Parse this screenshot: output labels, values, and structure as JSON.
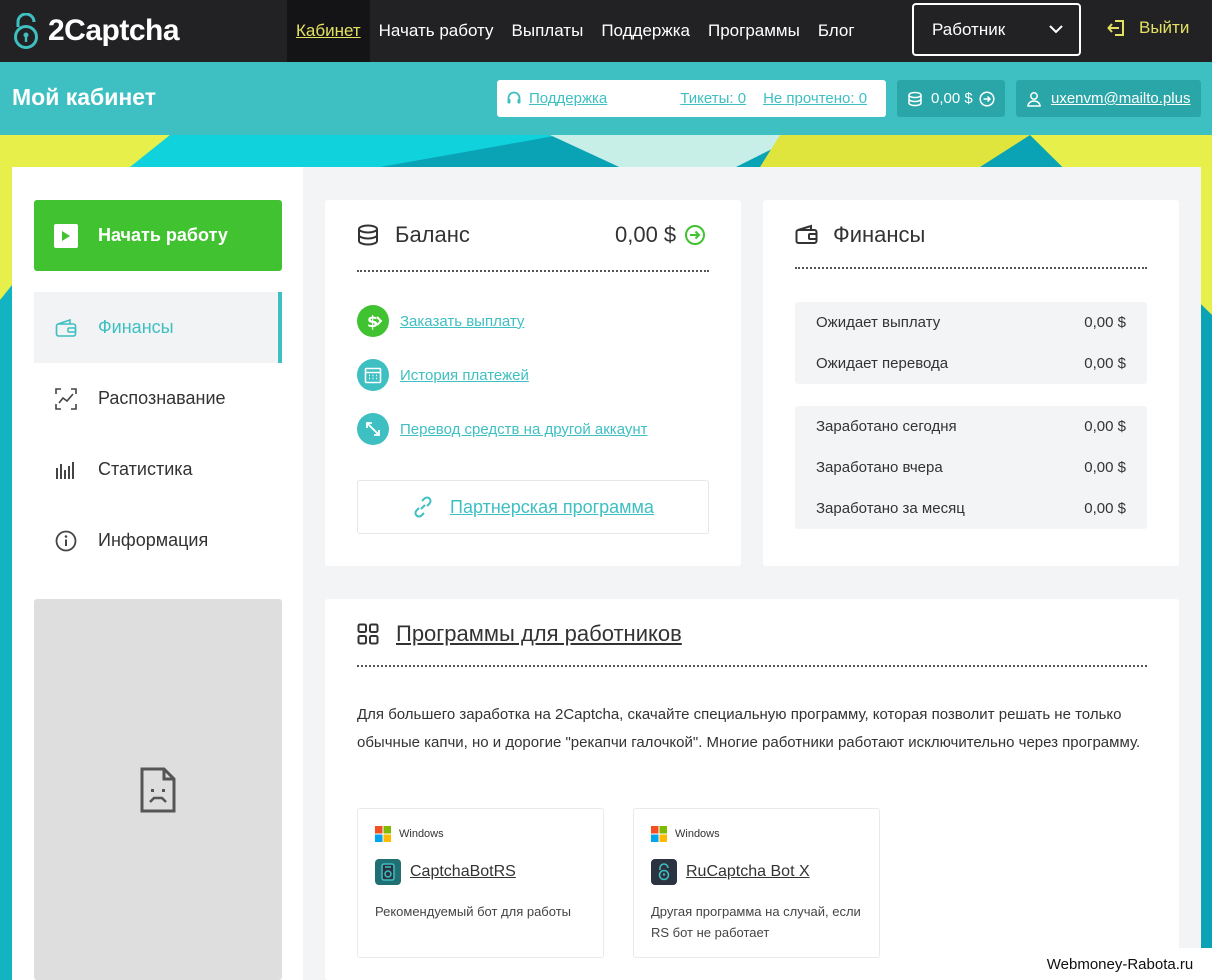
{
  "app": {
    "logo_text": "2Captcha"
  },
  "nav": {
    "items": [
      {
        "label": "Кабинет",
        "active": true
      },
      {
        "label": "Начать работу"
      },
      {
        "label": "Выплаты"
      },
      {
        "label": "Поддержка"
      },
      {
        "label": "Программы"
      },
      {
        "label": "Блог"
      }
    ],
    "role_select": "Работник",
    "logout": "Выйти"
  },
  "header": {
    "title": "Мой кабинет",
    "support": "Поддержка",
    "tickets": "Тикеты: 0",
    "unread": "Не прочтено: 0",
    "balance": "0,00 $",
    "user_email": "uxenvm@mailto.plus"
  },
  "sidebar": {
    "start_label": "Начать работу",
    "items": [
      {
        "label": "Финансы",
        "icon": "wallet-icon",
        "active": true
      },
      {
        "label": "Распознавание",
        "icon": "recognition-icon"
      },
      {
        "label": "Статистика",
        "icon": "chart-bars-icon"
      },
      {
        "label": "Информация",
        "icon": "info-icon"
      }
    ]
  },
  "balance_card": {
    "title": "Баланс",
    "amount": "0,00 $",
    "actions": [
      {
        "label": "Заказать выплату",
        "icon": "dollar-icon",
        "color": "#41c230"
      },
      {
        "label": "История платежей",
        "icon": "calendar-icon",
        "color": "#3ebfc2"
      },
      {
        "label": "Перевод средств на другой аккаунт",
        "icon": "transfer-icon",
        "color": "#3ebfc2"
      }
    ],
    "partner": "Партнерская программа"
  },
  "finance_card": {
    "title": "Финансы",
    "group1": [
      {
        "label": "Ожидает выплату",
        "value": "0,00 $"
      },
      {
        "label": "Ожидает перевода",
        "value": "0,00 $"
      }
    ],
    "group2": [
      {
        "label": "Заработано сегодня",
        "value": "0,00 $"
      },
      {
        "label": "Заработано вчера",
        "value": "0,00 $"
      },
      {
        "label": "Заработано за месяц",
        "value": "0,00 $"
      }
    ]
  },
  "programs": {
    "title": "Программы для работников",
    "description": "Для большего заработка на 2Captcha, скачайте специальную программу, которая позволит решать не только обычные капчи, но и дорогие \"рекапчи галочкой\". Многие работники работают исключительно через программу.",
    "items": [
      {
        "os": "Windows",
        "name": "CaptchaBotRS",
        "desc": "Рекомендуемый бот для работы"
      },
      {
        "os": "Windows",
        "name": "RuCaptcha Bot X",
        "desc": "Другая программа на случай, если RS бот не работает"
      }
    ]
  },
  "watermark": "Webmoney-Rabota.ru",
  "colors": {
    "accent": "#3ebfc2",
    "green": "#41c230",
    "dark": "#222224",
    "yellow": "#e3e062"
  }
}
